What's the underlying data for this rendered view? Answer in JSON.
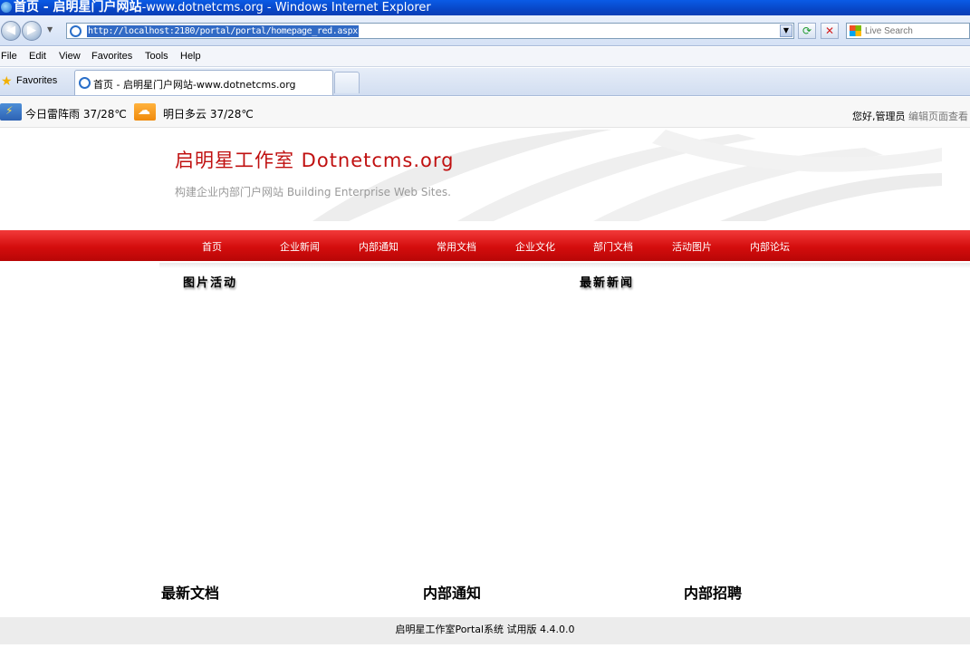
{
  "window": {
    "title_main": "首页 - 启明星门户网站",
    "title_rest": "-www.dotnetcms.org - Windows Internet Explorer"
  },
  "address": {
    "url": "http://localhost:2180/portal/portal/homepage_red.aspx"
  },
  "search": {
    "placeholder": "Live Search"
  },
  "menu": {
    "items": [
      "File",
      "Edit",
      "View",
      "Favorites",
      "Tools",
      "Help"
    ]
  },
  "tabs": {
    "favorites_label": "Favorites",
    "active_tab": "首页 - 启明星门户网站-www.dotnetcms.org"
  },
  "weather": {
    "today": "今日雷阵雨 37/28℃",
    "tomorrow": "明日多云 37/28℃"
  },
  "user": {
    "greeting": "您好,管理员",
    "edit_page": "编辑页面",
    "view": "查看"
  },
  "banner": {
    "title": "启明星工作室 Dotnetcms.org",
    "subtitle": "构建企业内部门户网站 Building Enterprise Web Sites."
  },
  "nav": {
    "items": [
      "首页",
      "企业新闻",
      "内部通知",
      "常用文档",
      "企业文化",
      "部门文档",
      "活动图片",
      "内部论坛"
    ]
  },
  "sections": {
    "photo_activity": "图片活动",
    "latest_news": "最新新闻",
    "latest_docs": "最新文档",
    "internal_notice": "内部通知",
    "internal_jobs": "内部招聘"
  },
  "footer": {
    "text": "启明星工作室Portal系统 试用版 4.4.0.0"
  },
  "colors": {
    "nav_red": "#d40d0d",
    "title_red": "#c01010",
    "ie_blue": "#0846c7"
  }
}
